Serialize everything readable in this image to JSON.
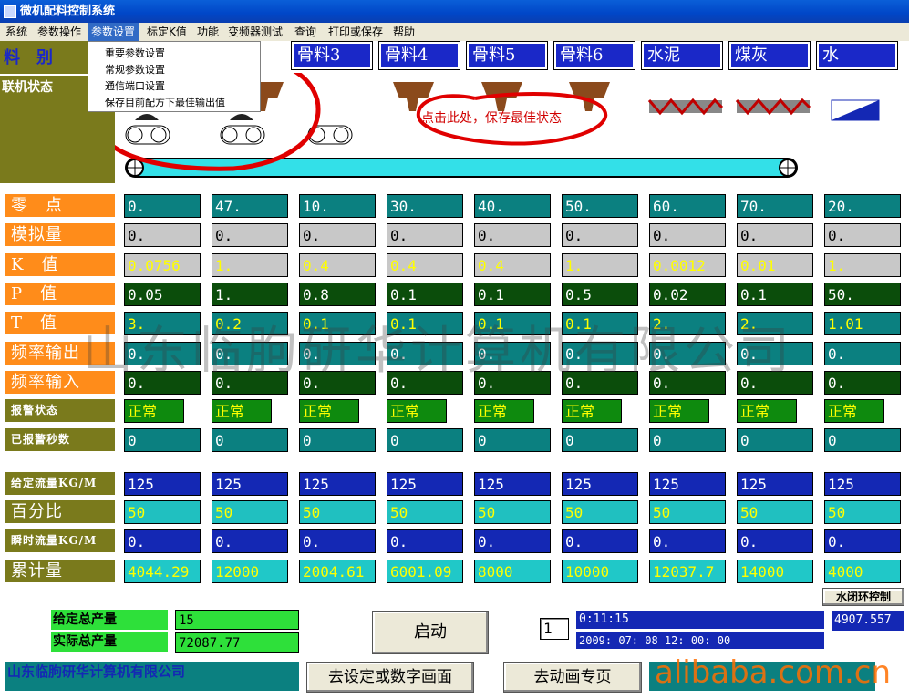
{
  "window": {
    "title": "微机配料控制系统"
  },
  "menu": [
    {
      "label": "系统",
      "active": false
    },
    {
      "label": "参数操作",
      "active": false
    },
    {
      "label": "参数设置",
      "active": true
    },
    {
      "label": "标定K值",
      "active": false
    },
    {
      "label": "功能",
      "active": false
    },
    {
      "label": "变频器测试",
      "active": false
    },
    {
      "label": "查询",
      "active": false
    },
    {
      "label": "打印或保存",
      "active": false
    },
    {
      "label": "帮助",
      "active": false
    }
  ],
  "dropdown": [
    "重要参数设置",
    "常规参数设置",
    "通信端口设置",
    "保存目前配方下最佳输出值"
  ],
  "annotation": "点击此处，保存最佳状态",
  "left_labels": {
    "material": "料　别",
    "link_status": "联机状态"
  },
  "materials": [
    "骨料3",
    "骨料4",
    "骨料5",
    "骨料6",
    "水泥",
    "煤灰",
    "水"
  ],
  "rows": [
    {
      "label": "零　点",
      "values": [
        "0.",
        "47.",
        "10.",
        "30.",
        "40.",
        "50.",
        "60.",
        "70.",
        "20."
      ]
    },
    {
      "label": "模拟量",
      "values": [
        "0.",
        "0.",
        "0.",
        "0.",
        "0.",
        "0.",
        "0.",
        "0.",
        "0."
      ]
    },
    {
      "label": "K　值",
      "values": [
        "0.0756",
        "1.",
        "0.4",
        "0.4",
        "0.4",
        "1.",
        "0.0012",
        "0.01",
        "1."
      ]
    },
    {
      "label": "P　值",
      "values": [
        "0.05",
        "1.",
        "0.8",
        "0.1",
        "0.1",
        "0.5",
        "0.02",
        "0.1",
        "50."
      ]
    },
    {
      "label": "T　值",
      "values": [
        "3.",
        "0.2",
        "0.1",
        "0.1",
        "0.1",
        "0.1",
        "2.",
        "2.",
        "1.01"
      ]
    },
    {
      "label": "频率输出",
      "values": [
        "0.",
        "0.",
        "0.",
        "0.",
        "0.",
        "0.",
        "0.",
        "0.",
        "0."
      ]
    },
    {
      "label": "频率输入",
      "values": [
        "0.",
        "0.",
        "0.",
        "0.",
        "0.",
        "0.",
        "0.",
        "0.",
        "0."
      ]
    },
    {
      "label": "报警状态",
      "values": [
        "正常",
        "正常",
        "正常",
        "正常",
        "正常",
        "正常",
        "正常",
        "正常",
        "正常"
      ]
    },
    {
      "label": "已报警秒数",
      "values": [
        "0",
        "0",
        "0",
        "0",
        "0",
        "0",
        "0",
        "0",
        "0"
      ]
    },
    {
      "label": "给定流量KG/M",
      "values": [
        "125",
        "125",
        "125",
        "125",
        "125",
        "125",
        "125",
        "125",
        "125"
      ]
    },
    {
      "label": "百分比",
      "values": [
        "50",
        "50",
        "50",
        "50",
        "50",
        "50",
        "50",
        "50",
        "50"
      ]
    },
    {
      "label": "瞬时流量KG/M",
      "values": [
        "0.",
        "0.",
        "0.",
        "0.",
        "0.",
        "0.",
        "0.",
        "0.",
        "0."
      ]
    },
    {
      "label": "累计量",
      "values": [
        "4044.29",
        "12000",
        "2004.61",
        "6001.09",
        "8000",
        "10000",
        "12037.7",
        "14000",
        "4000"
      ]
    }
  ],
  "watermark": "山东临朐研华计算机有限公司",
  "bottom": {
    "set_total_label": "给定总产量",
    "set_total_value": "15",
    "actual_total_label": "实际总产量",
    "actual_total_value": "72087.77",
    "start_button": "启动",
    "counter": "1",
    "timer": "0:11:15",
    "datetime": "2009: 07: 08 12: 00: 00",
    "water_loop_button": "水闭环控制",
    "water_value": "4907.557",
    "company": "山东临朐研华计算机有限公司",
    "goto_setting_button": "去设定或数字画面",
    "goto_animation_button": "去动画专页",
    "brand_watermark": "alibaba.com.cn"
  }
}
